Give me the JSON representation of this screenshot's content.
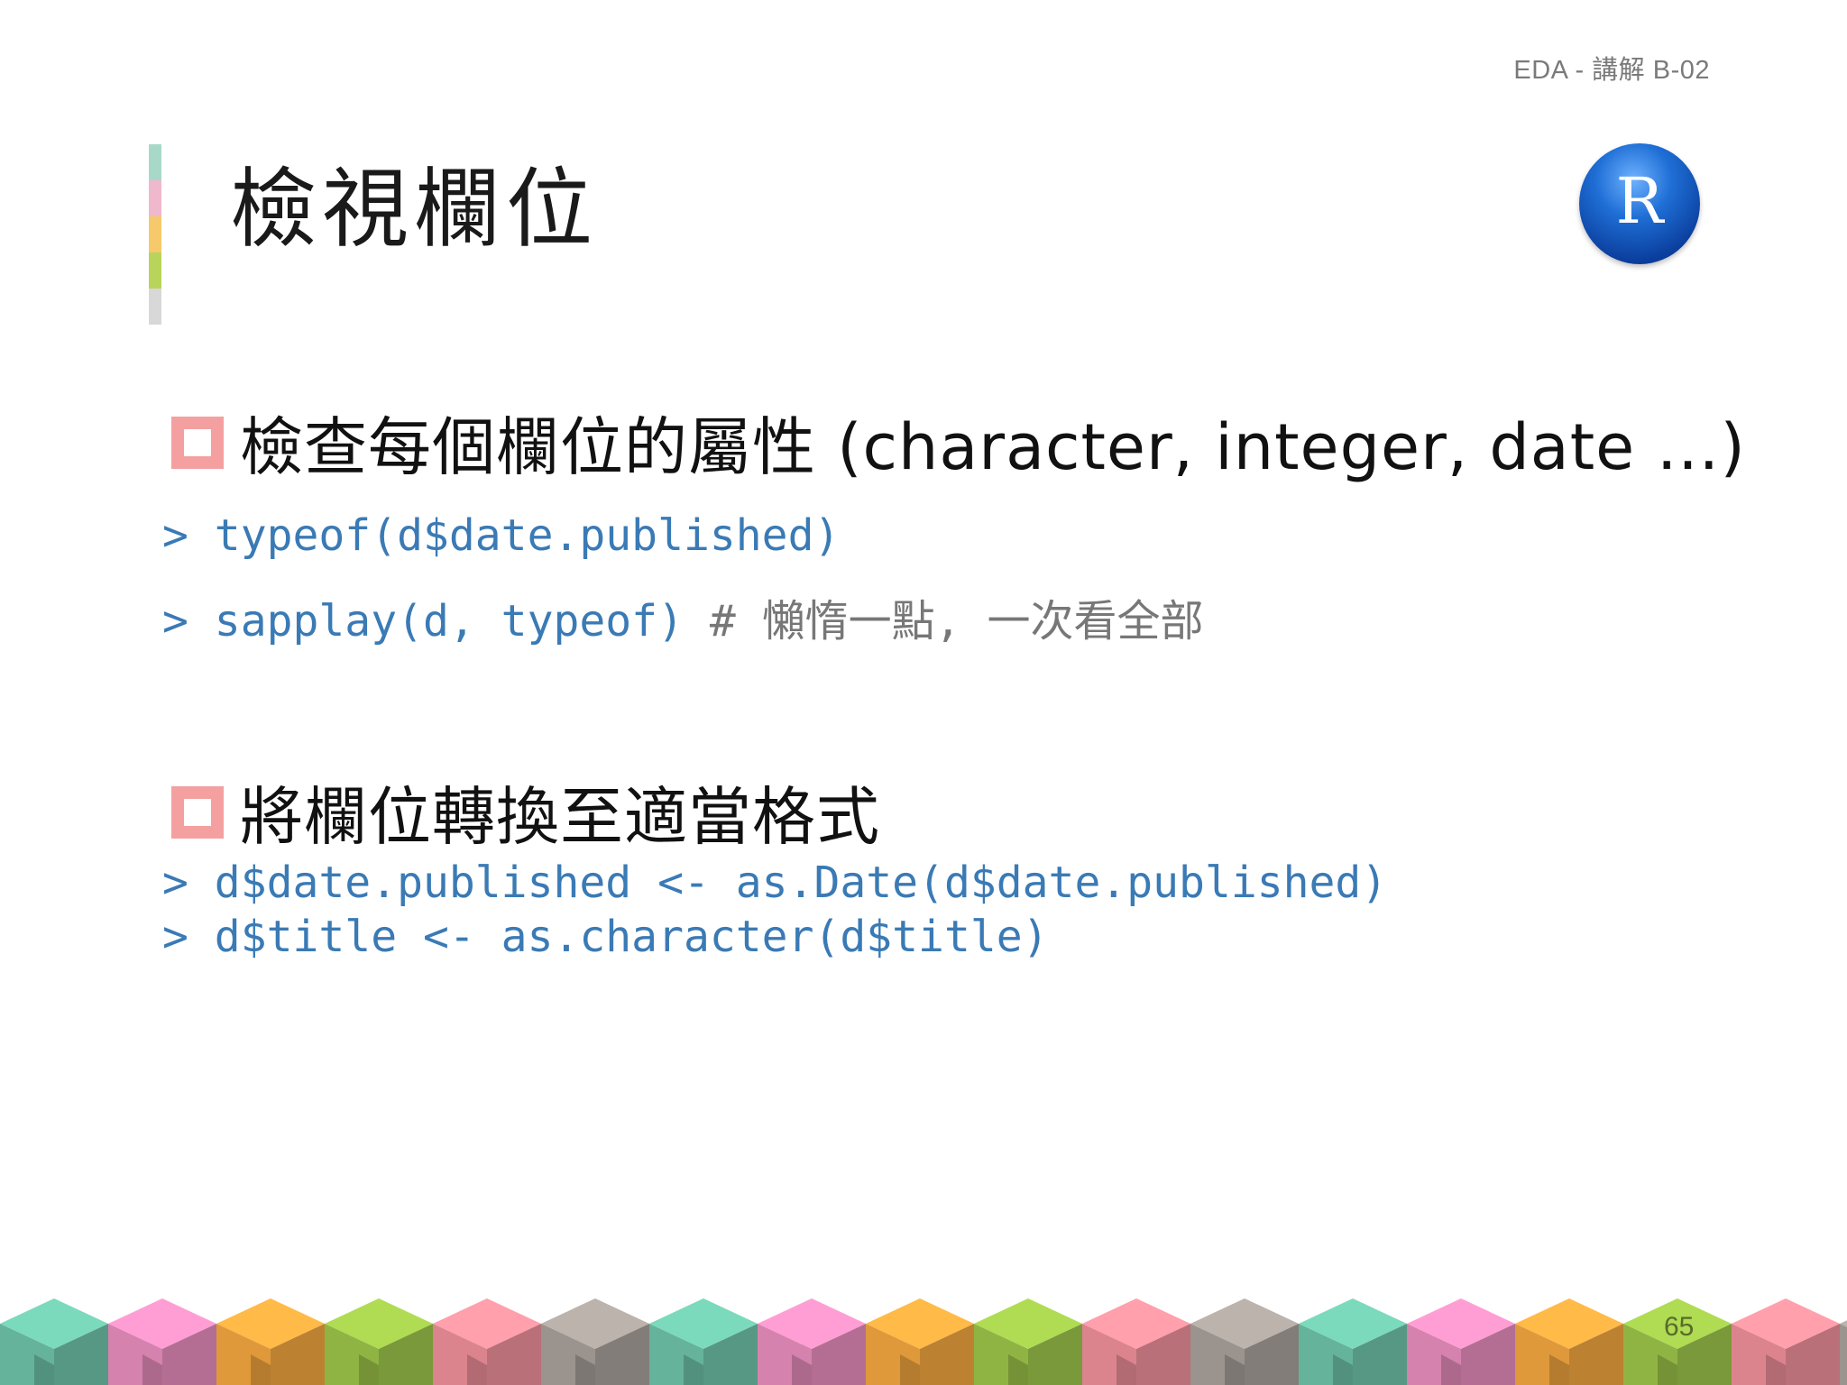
{
  "header": {
    "tag": "EDA - 講解 B-02"
  },
  "title": "檢視欄位",
  "logo": {
    "letter": "R"
  },
  "accent_colors": [
    "#a8d8c8",
    "#f0b8cc",
    "#f6c96a",
    "#b8d45a",
    "#d8d8d8"
  ],
  "bullets": [
    {
      "text": "檢查每個欄位的屬性 (character, integer, date …)",
      "code": [
        {
          "prompt": "> ",
          "code": "typeof(d$date.published)",
          "comment": ""
        },
        {
          "prompt": "> ",
          "code": "sapplay(d, typeof)",
          "comment": " # 懶惰一點, 一次看全部"
        }
      ]
    },
    {
      "text": "將欄位轉換至適當格式",
      "code": [
        {
          "prompt": "> ",
          "code": "d$date.published <- as.Date(d$date.published)",
          "comment": ""
        },
        {
          "prompt": "> ",
          "code": "d$title <- as.character(d$title)",
          "comment": ""
        }
      ]
    }
  ],
  "colors": {
    "bullet_box": "#f4a0a0",
    "code": "#3a7ab5",
    "comment": "#777777"
  },
  "cube_colors": [
    "#6ec3a8",
    "#e78dbd",
    "#f2a640",
    "#9cc44a",
    "#ef8f9a",
    "#a7a09a"
  ],
  "page_number": "65"
}
